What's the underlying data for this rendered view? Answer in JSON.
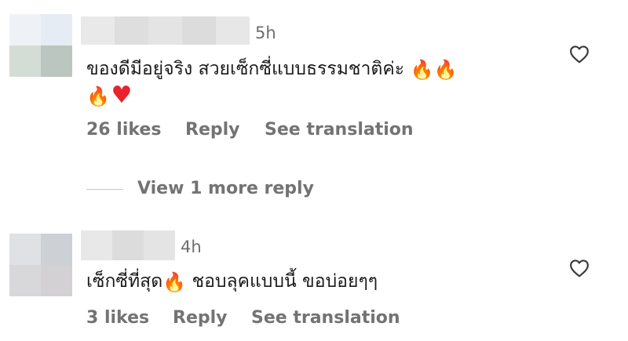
{
  "comments": [
    {
      "time": "5h",
      "text_line1": "ของดีมีอยู่จริง สวยเซ็กซี่แบบธรรมชาติค่ะ",
      "likes": "26 likes",
      "reply_label": "Reply",
      "translate_label": "See translation",
      "icons": [
        "fire-emoji",
        "fire-emoji",
        "fire-emoji",
        "red-heart-emoji",
        "heart-outline-icon"
      ]
    },
    {
      "time": "4h",
      "text_before": "เซ็กซี่ที่สุด",
      "text_after": "ชอบลุคแบบนี้ ขอบ่อยๆๆ",
      "likes": "3 likes",
      "reply_label": "Reply",
      "translate_label": "See translation",
      "icons": [
        "fire-emoji",
        "heart-outline-icon"
      ]
    }
  ],
  "view_more_replies": "View 1 more reply",
  "colors": {
    "meta_text": "#737373",
    "fire": "#f5731a",
    "red_heart": "#e8232e"
  }
}
